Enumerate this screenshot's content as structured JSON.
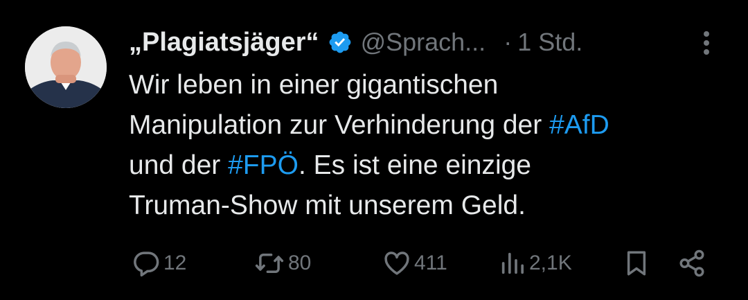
{
  "tweet": {
    "display_name": "„Plagiatsjäger“",
    "handle": "@Sprach...",
    "separator": "·",
    "time": "1 Std.",
    "text_lines": [
      [
        {
          "text": "Wir leben in einer gigantischen"
        }
      ],
      [
        {
          "text": "Manipulation zur Verhinderung der "
        },
        {
          "text": "#AfD",
          "hashtag": true
        }
      ],
      [
        {
          "text": "und der "
        },
        {
          "text": "#FPÖ",
          "hashtag": true
        },
        {
          "text": ". Es ist eine einzige"
        }
      ],
      [
        {
          "text": "Truman-Show mit unserem Geld."
        }
      ]
    ]
  },
  "actions": {
    "replies": "12",
    "reposts": "80",
    "likes": "411",
    "views": "2,1K"
  },
  "icons": {
    "verified": "verified-badge-icon",
    "more": "more-vertical-icon",
    "reply": "reply-icon",
    "repost": "repost-icon",
    "like": "heart-icon",
    "views": "views-icon",
    "bookmark": "bookmark-icon",
    "share": "share-icon"
  },
  "colors": {
    "background": "#000000",
    "text": "#e7e9ea",
    "muted": "#71767b",
    "accent": "#1d9bf0"
  }
}
